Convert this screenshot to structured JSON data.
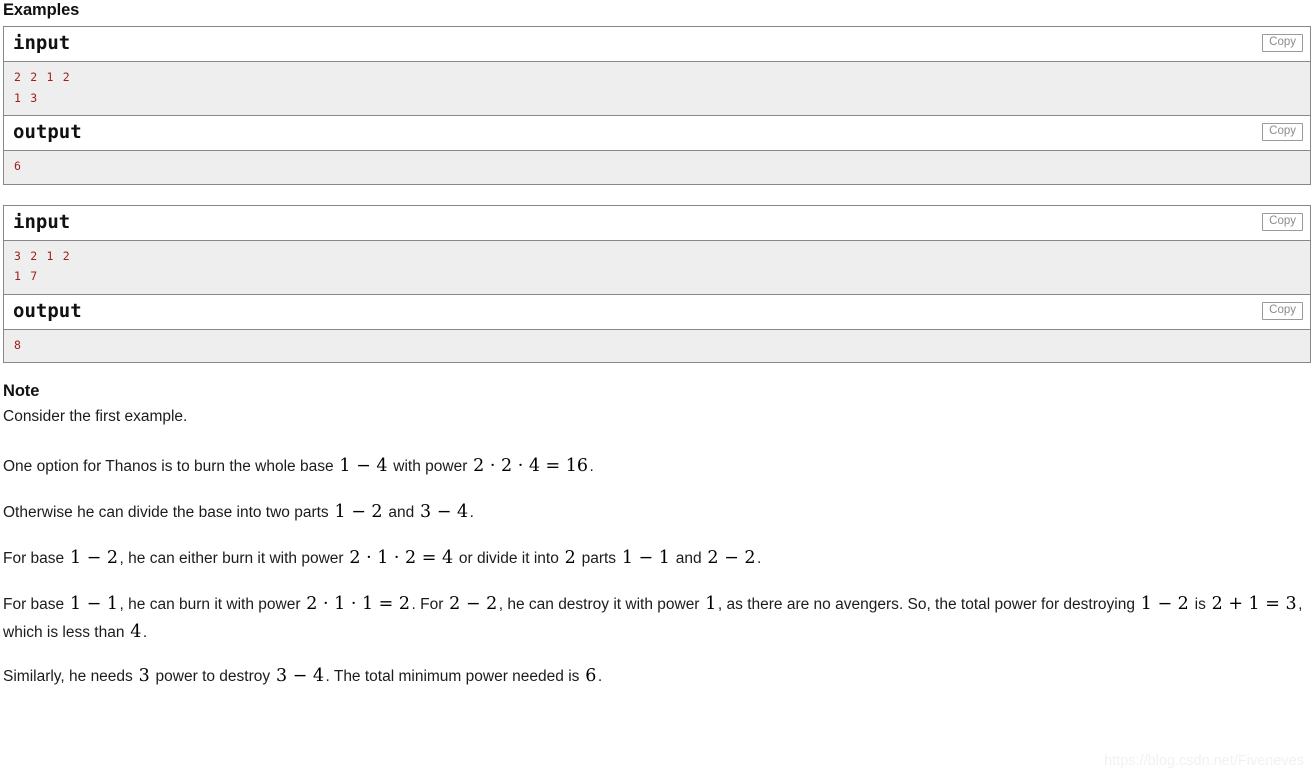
{
  "examples": {
    "heading": "Examples",
    "copy_label": "Copy",
    "tests": [
      {
        "input_label": "input",
        "input_text": "2 2 1 2\n1 3",
        "output_label": "output",
        "output_text": "6"
      },
      {
        "input_label": "input",
        "input_text": "3 2 1 2\n1 7",
        "output_label": "output",
        "output_text": "8"
      }
    ]
  },
  "note": {
    "heading": "Note",
    "paragraphs": [
      {
        "id": "p1",
        "parts": [
          {
            "t": "text",
            "v": "Consider the first example."
          }
        ]
      },
      {
        "id": "p2",
        "parts": [
          {
            "t": "text",
            "v": "One option for Thanos is to burn the whole base "
          },
          {
            "t": "math",
            "v": "1 − 4"
          },
          {
            "t": "text",
            "v": " with power "
          },
          {
            "t": "math",
            "v": "2 · 2 · 4 = 16"
          },
          {
            "t": "text",
            "v": "."
          }
        ]
      },
      {
        "id": "p3",
        "parts": [
          {
            "t": "text",
            "v": "Otherwise he can divide the base into two parts "
          },
          {
            "t": "math",
            "v": "1 − 2"
          },
          {
            "t": "text",
            "v": " and "
          },
          {
            "t": "math",
            "v": "3 − 4"
          },
          {
            "t": "text",
            "v": "."
          }
        ]
      },
      {
        "id": "p4",
        "parts": [
          {
            "t": "text",
            "v": "For base "
          },
          {
            "t": "math",
            "v": "1 − 2"
          },
          {
            "t": "text",
            "v": ", he can either burn it with power "
          },
          {
            "t": "math",
            "v": "2 · 1 · 2 = 4"
          },
          {
            "t": "text",
            "v": " or divide it into "
          },
          {
            "t": "math",
            "v": "2"
          },
          {
            "t": "text",
            "v": " parts "
          },
          {
            "t": "math",
            "v": "1 − 1"
          },
          {
            "t": "text",
            "v": " and "
          },
          {
            "t": "math",
            "v": "2 − 2"
          },
          {
            "t": "text",
            "v": "."
          }
        ]
      },
      {
        "id": "p5",
        "parts": [
          {
            "t": "text",
            "v": "For base "
          },
          {
            "t": "math",
            "v": "1 − 1"
          },
          {
            "t": "text",
            "v": ", he can burn it with power "
          },
          {
            "t": "math",
            "v": "2 · 1 · 1 = 2"
          },
          {
            "t": "text",
            "v": ". For "
          },
          {
            "t": "math",
            "v": "2 − 2"
          },
          {
            "t": "text",
            "v": ", he can destroy it with power "
          },
          {
            "t": "math",
            "v": "1"
          },
          {
            "t": "text",
            "v": ", as there are no avengers. So, the total power for destroying "
          },
          {
            "t": "math",
            "v": "1 − 2"
          },
          {
            "t": "text",
            "v": " is "
          },
          {
            "t": "math",
            "v": "2 + 1 = 3"
          },
          {
            "t": "text",
            "v": ", which is less than "
          },
          {
            "t": "math",
            "v": "4"
          },
          {
            "t": "text",
            "v": "."
          }
        ]
      },
      {
        "id": "p6",
        "parts": [
          {
            "t": "text",
            "v": "Similarly, he needs "
          },
          {
            "t": "math",
            "v": "3"
          },
          {
            "t": "text",
            "v": " power to destroy "
          },
          {
            "t": "math",
            "v": "3 − 4"
          },
          {
            "t": "text",
            "v": ". The total minimum power needed is "
          },
          {
            "t": "math",
            "v": "6"
          },
          {
            "t": "text",
            "v": "."
          }
        ]
      }
    ]
  },
  "watermark": {
    "text": "https://blog.csdn.net/Fiveneves"
  },
  "colors": {
    "sample_text": "#a02020",
    "sample_bg": "#eeeeee",
    "border": "#888888",
    "copy_border": "#9a9a9a",
    "copy_text": "#8c8c8c",
    "watermark": "#f1f1f1"
  }
}
